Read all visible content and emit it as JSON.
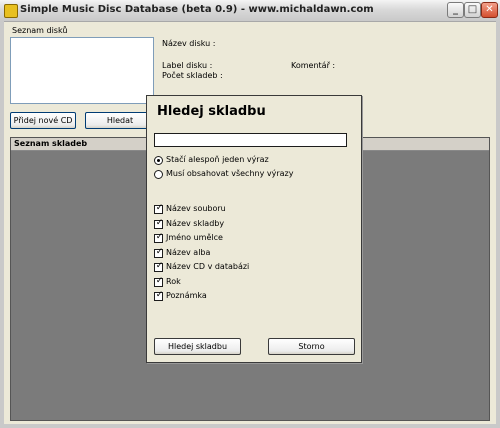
{
  "window": {
    "title": "Simple Music Disc Database (beta 0.9) - www.michaldawn.com"
  },
  "controls": {
    "minimize": "_",
    "maximize": "□",
    "close": "✕"
  },
  "disc_list": {
    "label": "Seznam disků"
  },
  "disc_info": {
    "name_label": "Název disku :",
    "label_label": "Label disku :",
    "comment_label": "Komentář :",
    "track_count_label": "Počet skladeb :"
  },
  "buttons": {
    "add_cd": "Přidej nové CD",
    "search": "Hledat"
  },
  "track_list": {
    "label": "Seznam skladeb"
  },
  "dialog": {
    "title": "Hledej skladbu",
    "query": "",
    "radios": [
      {
        "label": "Stačí alespoň jeden výraz",
        "selected": true
      },
      {
        "label": "Musí obsahovat všechny výrazy",
        "selected": false
      }
    ],
    "checkboxes": [
      {
        "label": "Název souboru",
        "checked": true
      },
      {
        "label": "Název skladby",
        "checked": true
      },
      {
        "label": "Jméno umělce",
        "checked": true
      },
      {
        "label": "Název alba",
        "checked": true
      },
      {
        "label": "Název CD v databázi",
        "checked": true
      },
      {
        "label": "Rok",
        "checked": true
      },
      {
        "label": "Poznámka",
        "checked": true
      }
    ],
    "ok_button": "Hledej skladbu",
    "cancel_button": "Storno"
  }
}
